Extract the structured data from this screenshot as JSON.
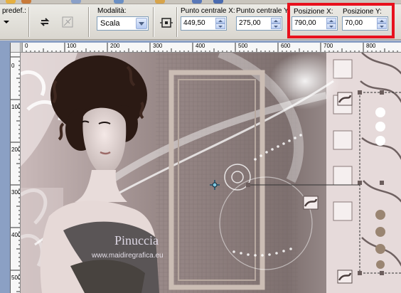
{
  "toolbar": {
    "preset_label": "predef.:",
    "mode_label": "Modalità:",
    "mode_value": "Scala",
    "center_x_label": "Punto centrale X:",
    "center_x_value": "449,50",
    "center_y_label": "Punto centrale Y:",
    "center_y_value": "275,00",
    "pos_x_label": "Posizione X:",
    "pos_x_value": "790,00",
    "pos_y_label": "Posizione Y:",
    "pos_y_value": "70,00",
    "highlight_color": "#e8111d"
  },
  "ruler": {
    "h_ticks": [
      "0",
      "100",
      "200",
      "300",
      "400",
      "500",
      "600",
      "700",
      "800"
    ],
    "v_ticks": [
      "0",
      "100",
      "200",
      "300",
      "400",
      "500"
    ]
  },
  "canvas": {
    "watermark_title": "Pinuccia",
    "watermark_url": "www.maidiregrafica.eu"
  },
  "colors": {
    "workspace_bg": "#8ba0c4",
    "toolbar_bg": "#e4e2dc"
  }
}
